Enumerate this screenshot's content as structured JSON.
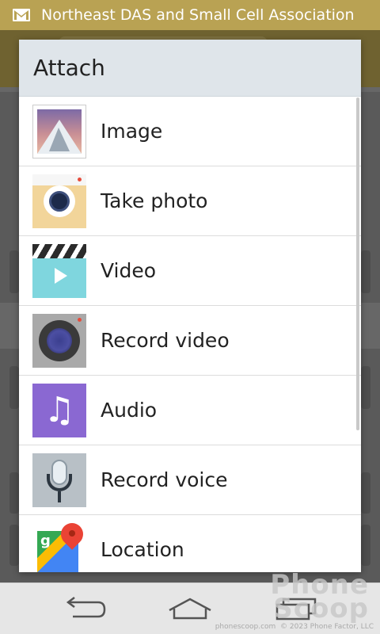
{
  "status_bar": {
    "icon": "gmail-icon",
    "title": "Northeast DAS and Small Cell Association"
  },
  "dialog": {
    "title": "Attach",
    "items": [
      {
        "label": "Image",
        "icon": "image-icon"
      },
      {
        "label": "Take photo",
        "icon": "camera-icon"
      },
      {
        "label": "Video",
        "icon": "video-icon"
      },
      {
        "label": "Record video",
        "icon": "record-video-icon"
      },
      {
        "label": "Audio",
        "icon": "audio-icon"
      },
      {
        "label": "Record voice",
        "icon": "microphone-icon"
      },
      {
        "label": "Location",
        "icon": "maps-icon"
      }
    ]
  },
  "navbar": {
    "buttons": [
      "back-icon",
      "home-icon",
      "recent-apps-icon"
    ]
  },
  "watermark": {
    "brand": "Phone Scoop",
    "url": "phonescoop.com",
    "copyright": "© 2023 Phone Factor, LLC"
  },
  "colors": {
    "status_bar": "#b9a253",
    "dialog_header": "#dfe5ea",
    "dim_background": "#5a5a5a"
  }
}
